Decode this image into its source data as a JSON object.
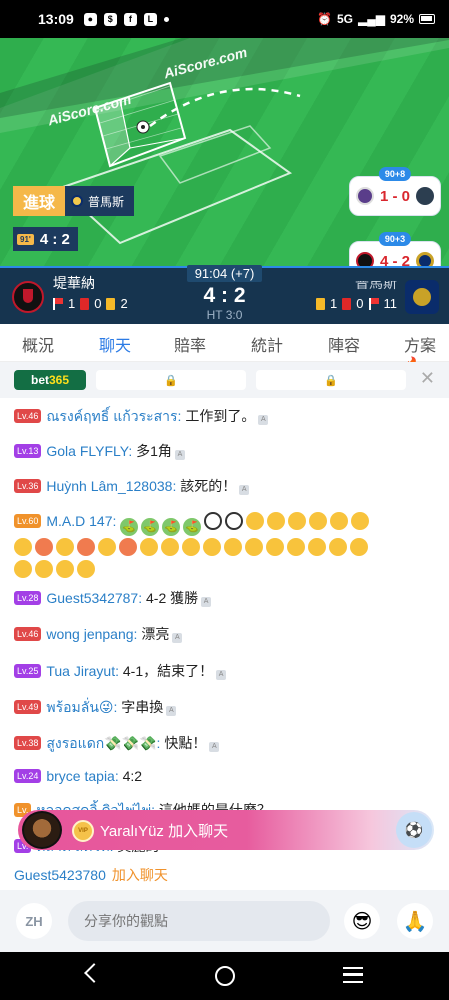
{
  "status_bar": {
    "time": "13:09",
    "icons": [
      "message-icon",
      "dollar-icon",
      "facebook-icon",
      "line-icon",
      "dot-icon"
    ],
    "right_icons": [
      "alarm-icon",
      "volte-icon",
      "signal-icon",
      "battery-icon"
    ],
    "network": "5G",
    "battery": "92%"
  },
  "pitch": {
    "watermark": "AiScore.com",
    "goal_label": "進球",
    "goal_team": "普馬斯",
    "minute_tag": "91'",
    "live_score": "4 : 2",
    "side_cards": [
      {
        "minute": "90+8",
        "score": "1 - 0"
      },
      {
        "minute": "90+3",
        "score": "4 - 2"
      }
    ]
  },
  "match": {
    "home_team": "堤華納",
    "away_team": "普馬斯",
    "clock": "91:04 (+7)",
    "score": "4 : 2",
    "half_time": "HT 3:0",
    "home_stats": {
      "corners": "1",
      "red": "0",
      "yellow": "2"
    },
    "away_stats": {
      "yellow": "1",
      "red": "0",
      "corners": "11"
    }
  },
  "tabs": [
    "概況",
    "聊天",
    "賠率",
    "統計",
    "陣容",
    "方案"
  ],
  "odds": {
    "brand": "bet",
    "brand_num": "365",
    "close": "✕"
  },
  "chat": [
    {
      "level": "Lv.46",
      "user": "ณรงค์ฤทธิ์ แก้วระสาร:",
      "text": "工作到了。"
    },
    {
      "level": "Lv.13",
      "user": "Gola FLYFLY:",
      "text": "多1角"
    },
    {
      "level": "Lv.36",
      "user": "Huỳnh Lâm_128038:",
      "text": "該死的！"
    },
    {
      "level": "Lv.60",
      "user": "M.A.D 147:",
      "text": ""
    },
    {
      "level": "Lv.28",
      "user": "Guest5342787:",
      "text": "4-2 獲勝"
    },
    {
      "level": "Lv.46",
      "user": "wong jenpang:",
      "text": "漂亮"
    },
    {
      "level": "Lv.25",
      "user": "Tua Jirayut:",
      "text": "4-1，結束了！"
    },
    {
      "level": "Lv.49",
      "user": "พร้อมลั่น😜:",
      "text": "字串換"
    },
    {
      "level": "Lv.38",
      "user": "สูงรอแดก💸💸💸:",
      "text": "快點！"
    },
    {
      "level": "Lv.24",
      "user": "bryce tapia:",
      "text": "4:2"
    },
    {
      "level": "Lv.",
      "user": "หลอดสุดอิ้ ดิวไพ่ไพ่:",
      "text": "這他媽的是什麼？"
    },
    {
      "level": "Lv.",
      "user": "ตลาด สัตวท:",
      "text": "美麗的"
    }
  ],
  "join_banner": {
    "coin": "VIP",
    "name": "YaralıYüz",
    "text": "加入聊天"
  },
  "guest_join": {
    "name": "Guest5423780",
    "text": "加入聊天"
  },
  "input": {
    "lang": "ZH",
    "placeholder": "分享你的觀點"
  },
  "colors": {
    "accent": "#2c7be5",
    "score_bar": "#16344f",
    "pitch": "#2fae4d",
    "banner": "#e7569b"
  }
}
